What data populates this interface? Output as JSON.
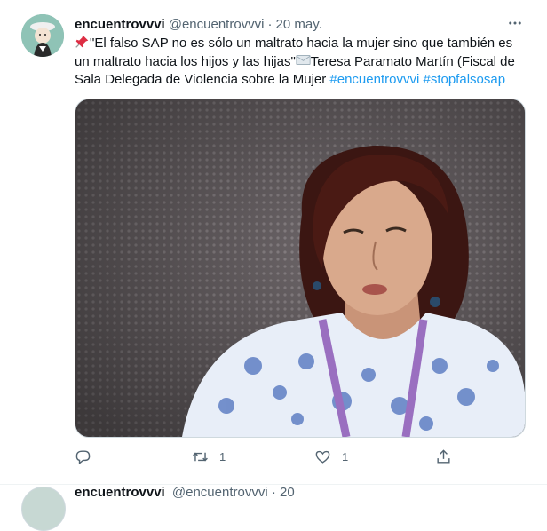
{
  "tweet": {
    "display_name": "encuentrovvvi",
    "handle": "@encuentrovvvi",
    "separator": "·",
    "date": "20 may.",
    "more_icon": "more-horizontal-icon",
    "text": {
      "part1": "\"El falso SAP no es sólo un maltrato hacia la mujer sino que también es un maltrato hacia los hijos y las hijas\"",
      "part2": "Teresa Paramato Martín (Fiscal de Sala Delegada de Violencia sobre la Mujer ",
      "hashtag1": "#encuentrovvvi",
      "space": " ",
      "hashtag2": "#stopfalsosap"
    },
    "emojis": {
      "first": "pushpin-icon",
      "second": "envelope-icon"
    },
    "media": {
      "description_icon": "photo"
    },
    "actions": {
      "reply_icon": "reply-icon",
      "retweet_count": "1",
      "like_count": "1",
      "share_icon": "share-icon"
    }
  },
  "next_tweet": {
    "display_name": "encuentrovvvi",
    "handle": "@encuentrovvvi · 20"
  },
  "colors": {
    "link": "#1d9bf0",
    "secondary_text": "#536471",
    "primary_text": "#0f1419",
    "border": "#eff3f4"
  }
}
